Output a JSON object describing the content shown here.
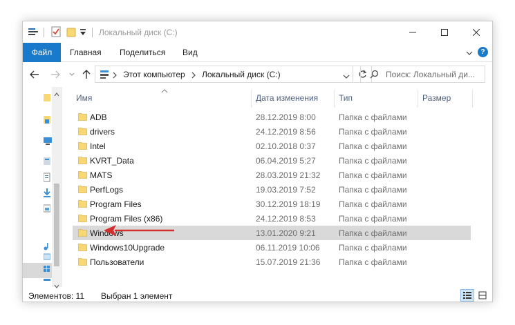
{
  "window": {
    "title": "Локальный диск (C:)"
  },
  "ribbon": {
    "tabs": [
      "Файл",
      "Главная",
      "Поделиться",
      "Вид"
    ],
    "help": "?"
  },
  "address": {
    "crumbs": [
      "Этот компьютер",
      "Локальный диск (C:)"
    ],
    "search_placeholder": "Поиск: Локальный ди..."
  },
  "columns": {
    "name": "Имя",
    "date": "Дата изменения",
    "type": "Тип",
    "size": "Размер"
  },
  "files": [
    {
      "name": "ADB",
      "date": "28.12.2019 8:00",
      "type": "Папка с файлами"
    },
    {
      "name": "drivers",
      "date": "24.12.2019 8:56",
      "type": "Папка с файлами"
    },
    {
      "name": "Intel",
      "date": "02.10.2018 0:37",
      "type": "Папка с файлами"
    },
    {
      "name": "KVRT_Data",
      "date": "06.04.2019 5:27",
      "type": "Папка с файлами"
    },
    {
      "name": "MATS",
      "date": "28.03.2019 21:32",
      "type": "Папка с файлами"
    },
    {
      "name": "PerfLogs",
      "date": "19.03.2019 7:52",
      "type": "Папка с файлами"
    },
    {
      "name": "Program Files",
      "date": "30.12.2019 18:19",
      "type": "Папка с файлами"
    },
    {
      "name": "Program Files (x86)",
      "date": "24.12.2019 8:53",
      "type": "Папка с файлами"
    },
    {
      "name": "Windows",
      "date": "13.01.2020 9:21",
      "type": "Папка с файлами",
      "selected": true
    },
    {
      "name": "Windows10Upgrade",
      "date": "06.11.2019 10:06",
      "type": "Папка с файлами"
    },
    {
      "name": "Пользователи",
      "date": "15.07.2019 21:36",
      "type": "Папка с файлами"
    }
  ],
  "status": {
    "count": "Элементов: 11",
    "selected": "Выбран 1 элемент"
  },
  "colors": {
    "accent": "#1979ca",
    "folder": "#f8d775",
    "selection": "#d9d9d9",
    "annotation_arrow": "#d32f2f"
  }
}
